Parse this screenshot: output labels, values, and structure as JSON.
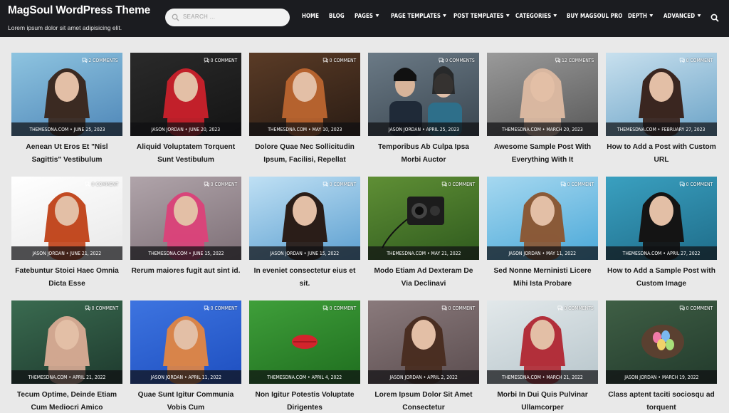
{
  "header": {
    "site_title": "MagSoul WordPress Theme",
    "tagline": "Lorem ipsum dolor sit amet adipisicing elit.",
    "search_placeholder": "SEARCH ...",
    "nav": [
      {
        "label": "HOME",
        "caret": false
      },
      {
        "label": "BLOG",
        "caret": false
      },
      {
        "label": "PAGES",
        "caret": true
      },
      {
        "label": "PAGE TEMPLATES",
        "caret": true
      },
      {
        "label": "POST TEMPLATES",
        "caret": true
      },
      {
        "label": "CATEGORIES",
        "caret": true
      },
      {
        "label": "BUY MAGSOUL PRO",
        "caret": false
      },
      {
        "label": "DEPTH",
        "caret": true
      },
      {
        "label": "ADVANCED",
        "caret": true
      }
    ]
  },
  "posts": [
    {
      "comments": "2 COMMENTS",
      "meta": "THEMESDNA.COM • JUNE 25, 2023",
      "title": "Aenean Ut Eros Et \"Nisl Sagittis\" Vestibulum",
      "colors": [
        "#4f87b8",
        "#8ec4e0"
      ],
      "subject": "#3b2a22",
      "scene": "woman-skyline"
    },
    {
      "comments": "0 COMMENT",
      "meta": "JASON JORDAN • JUNE 20, 2023",
      "title": "Aliquid Voluptatem Torquent Sunt Vestibulum",
      "colors": [
        "#141414",
        "#2a2a2a"
      ],
      "subject": "#c2202a",
      "scene": "woman-red"
    },
    {
      "comments": "0 COMMENT",
      "meta": "THEMESDNA.COM • MAY 10, 2023",
      "title": "Dolore Quae Nec Sollicitudin Ipsum, Facilisi, Repellat",
      "colors": [
        "#2a1c14",
        "#5a3b26"
      ],
      "subject": "#b5622e",
      "scene": "woman-curls"
    },
    {
      "comments": "0 COMMENTS",
      "meta": "JASON JORDAN • APRIL 25, 2023",
      "title": "Temporibus Ab Culpa Ipsa Morbi Auctor",
      "colors": [
        "#3a4650",
        "#6b7a86"
      ],
      "subject": "#1f2a38",
      "scene": "two-women"
    },
    {
      "comments": "12 COMMENTS",
      "meta": "THEMESDNA.COM • MARCH 20, 2023",
      "title": "Awesome Sample Post With Everything With It",
      "colors": [
        "#5a5a5a",
        "#9a9a9a"
      ],
      "subject": "#d9b7a0",
      "scene": "flower-crown"
    },
    {
      "comments": "0 COMMENT",
      "meta": "THEMESDNA.COM • FEBRUARY 27, 2023",
      "title": "How to Add a Post with Custom URL",
      "colors": [
        "#6ba3c7",
        "#c8e0ee"
      ],
      "subject": "#3a2620",
      "scene": "woman-blue"
    },
    {
      "comments": "0 COMMENT",
      "meta": "JASON JORDAN • JUNE 21, 2022",
      "title": "Fatebuntur Stoici Haec Omnia Dicta Esse",
      "colors": [
        "#e8e8e8",
        "#ffffff"
      ],
      "subject": "#c24a22",
      "scene": "red-hair"
    },
    {
      "comments": "0 COMMENT",
      "meta": "THEMESDNA.COM • JUNE 15, 2022",
      "title": "Rerum maiores fugit aut sint id.",
      "colors": [
        "#7d6f76",
        "#b0a4aa"
      ],
      "subject": "#d8457a",
      "scene": "sunglasses"
    },
    {
      "comments": "0 COMMENT",
      "meta": "JASON JORDAN • JUNE 15, 2022",
      "title": "In eveniet consectetur eius et sit.",
      "colors": [
        "#5c9fd0",
        "#bfe0f4"
      ],
      "subject": "#2a1d18",
      "scene": "hair-wind"
    },
    {
      "comments": "0 COMMENT",
      "meta": "THEMESDNA.COM • MAY 21, 2022",
      "title": "Modo Etiam Ad Dexteram De Via Declinavi",
      "colors": [
        "#2f5a1e",
        "#5f8f35"
      ],
      "subject": "#1c1c1c",
      "scene": "camera-grass"
    },
    {
      "comments": "0 COMMENT",
      "meta": "JASON JORDAN • MAY 11, 2022",
      "title": "Sed Nonne Merninisti Licere Mihi Ista Probare",
      "colors": [
        "#4aa8d8",
        "#a6d8f0"
      ],
      "subject": "#8a5a38",
      "scene": "hat-woman"
    },
    {
      "comments": "0 COMMENT",
      "meta": "THEMESDNA.COM • APRIL 27, 2022",
      "title": "How to Add a Sample Post with Custom Image",
      "colors": [
        "#1f6d8a",
        "#3aa0c0"
      ],
      "subject": "#141414",
      "scene": "dark-hair-blue"
    },
    {
      "comments": "0 COMMENT",
      "meta": "THEMESDNA.COM • APRIL 21, 2022",
      "title": "Tecum Optime, Deinde Etiam Cum Mediocri Amico",
      "colors": [
        "#1e3a2e",
        "#3a6b50"
      ],
      "subject": "#d1a790",
      "scene": "woman-leaves"
    },
    {
      "comments": "0 COMMENT",
      "meta": "JASON JORDAN • APRIL 11, 2022",
      "title": "Quae Sunt Igitur Communia Vobis Cum",
      "colors": [
        "#1e4fc0",
        "#3d74e0"
      ],
      "subject": "#d8844a",
      "scene": "blue-bg"
    },
    {
      "comments": "0 COMMENT",
      "meta": "THEMESDNA.COM • APRIL 4, 2022",
      "title": "Non Igitur Potestis Voluptate Dirigentes",
      "colors": [
        "#1f6e1f",
        "#3f9f3a"
      ],
      "subject": "#d3242c",
      "scene": "clover-lips"
    },
    {
      "comments": "0 COMMENT",
      "meta": "JASON JORDAN • APRIL 2, 2022",
      "title": "Lorem Ipsum Dolor Sit Amet Consectetur",
      "colors": [
        "#5b4d4f",
        "#8a7a7c"
      ],
      "subject": "#4a2e22",
      "scene": "glasses-woman"
    },
    {
      "comments": "0 COMMENTS",
      "meta": "THEMESDNA.COM • MARCH 21, 2022",
      "title": "Morbi In Dui Quis Pulvinar Ullamcorper",
      "colors": [
        "#b8c6cc",
        "#e2e8ea"
      ],
      "subject": "#b22f3a",
      "scene": "tree-woman"
    },
    {
      "comments": "0 COMMENT",
      "meta": "JASON JORDAN • MARCH 19, 2022",
      "title": "Class aptent taciti sociosqu ad torquent",
      "colors": [
        "#223a2c",
        "#3f5f45"
      ],
      "subject": "#3a2a20",
      "scene": "easter-eggs"
    }
  ]
}
